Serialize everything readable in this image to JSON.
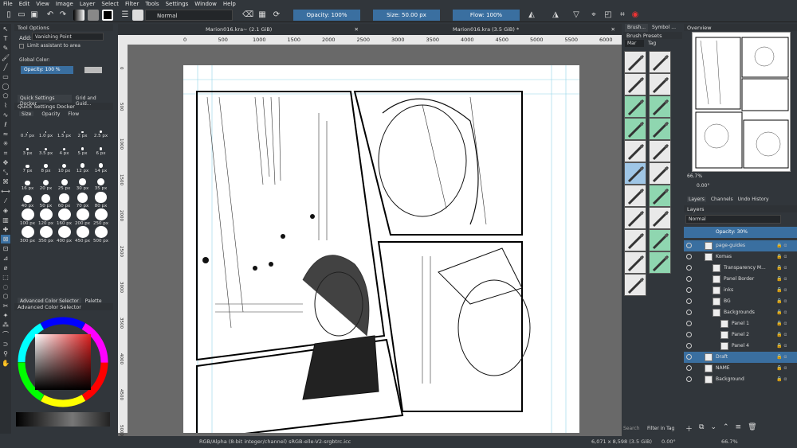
{
  "menu": [
    "File",
    "Edit",
    "View",
    "Image",
    "Layer",
    "Select",
    "Filter",
    "Tools",
    "Settings",
    "Window",
    "Help"
  ],
  "toolbar": {
    "blend_mode": "Normal",
    "opacity": "Opacity: 100%",
    "size": "Size: 50.00 px",
    "flow": "Flow: 100%"
  },
  "tool_options": {
    "title": "Tool Options",
    "add_label": "Add:",
    "add_value": "Vanishing Point",
    "limit_label": "Limit assistant to area",
    "global_color_label": "Global Color:",
    "opacity_value": "Opacity: 100 %"
  },
  "quick_settings": {
    "tab1": "Quick Settings Docker",
    "tab2": "Grid and Guid...",
    "title": "Quick Settings Docker",
    "subtabs": [
      "Size",
      "Opacity",
      "Flow"
    ],
    "sizes": [
      "0.7 px",
      "1.0 px",
      "1.5 px",
      "2 px",
      "2.5 px",
      "3 px",
      "3.5 px",
      "4 px",
      "5 px",
      "6 px",
      "7 px",
      "8 px",
      "10 px",
      "12 px",
      "14 px",
      "16 px",
      "20 px",
      "25 px",
      "30 px",
      "35 px",
      "40 px",
      "50 px",
      "60 px",
      "70 px",
      "80 px",
      "100 px",
      "120 px",
      "160 px",
      "200 px",
      "250 px",
      "300 px",
      "350 px",
      "400 px",
      "450 px",
      "500 px"
    ]
  },
  "color_selector": {
    "tab1": "Advanced Color Selector",
    "tab2": "Palette",
    "title": "Advanced Color Selector"
  },
  "tabs": [
    {
      "label": "Marion016.kra~ (2.1 GiB)"
    },
    {
      "label": "Marion016.kra (3.5 GiB) *"
    }
  ],
  "ruler_labels": [
    "0",
    "500",
    "1000",
    "1500",
    "2000",
    "2500",
    "3000",
    "3500",
    "4000",
    "4500",
    "5000",
    "5500",
    "6000"
  ],
  "ruler_v_labels": [
    "0",
    "500",
    "1000",
    "1500",
    "2000",
    "2500",
    "3000",
    "3500",
    "4000",
    "4500",
    "5000"
  ],
  "brush_presets": {
    "tab1": "Brush...",
    "tab2": "Symbol ...",
    "title": "Brush Presets",
    "filter_value": "Mar",
    "tag_label": "Tag",
    "search_placeholder": "Search",
    "filter_in_tag": "Filter in Tag"
  },
  "overview": {
    "title": "Overview",
    "zoom": "66.7%",
    "rotation": "0.00°"
  },
  "layers_panel": {
    "tabs": [
      "Layers",
      "Channels",
      "Undo History"
    ],
    "title": "Layers",
    "blend_mode": "Normal",
    "opacity": "Opacity:  30%",
    "layers": [
      {
        "name": "page-guides",
        "indent": 0,
        "selected": true
      },
      {
        "name": "Komas",
        "indent": 0,
        "selected": false
      },
      {
        "name": "Transparency M...",
        "indent": 1,
        "selected": false
      },
      {
        "name": "Panel Border",
        "indent": 1,
        "selected": false
      },
      {
        "name": "inks",
        "indent": 1,
        "selected": false
      },
      {
        "name": "BG",
        "indent": 1,
        "selected": false
      },
      {
        "name": "Backgrounds",
        "indent": 1,
        "selected": false
      },
      {
        "name": "Panel 1",
        "indent": 2,
        "selected": false
      },
      {
        "name": "Panel 2",
        "indent": 2,
        "selected": false
      },
      {
        "name": "Panel 4",
        "indent": 2,
        "selected": false
      },
      {
        "name": "Draft",
        "indent": 0,
        "selected": true
      },
      {
        "name": "NAME",
        "indent": 0,
        "selected": false
      },
      {
        "name": "Background",
        "indent": 0,
        "selected": false
      }
    ]
  },
  "status": {
    "color_space": "RGB/Alpha (8-bit integer/channel)  sRGB-elle-V2-srgbtrc.icc",
    "dimensions": "6,071 x 8,598 (3.5 GiB)",
    "rotation": "0.00°",
    "zoom": "66.7%"
  }
}
